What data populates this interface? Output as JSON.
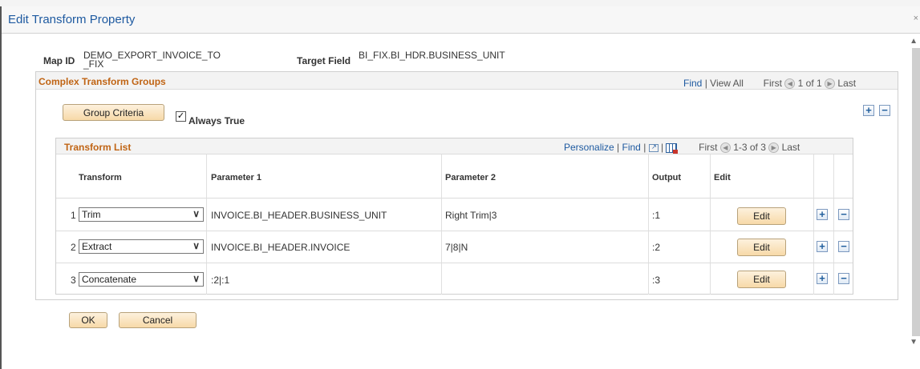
{
  "dialog": {
    "title": "Edit Transform Property",
    "close_label": "×"
  },
  "fields": {
    "map_id_label": "Map ID",
    "map_id_value_line1": "DEMO_EXPORT_INVOICE_TO",
    "map_id_value_line2": "_FIX",
    "target_field_label": "Target Field",
    "target_field_value": "BI_FIX.BI_HDR.BUSINESS_UNIT"
  },
  "groups": {
    "title": "Complex Transform Groups",
    "find": "Find",
    "separator": "|",
    "view_all": "View All",
    "first": "First",
    "range": "1 of 1",
    "last": "Last",
    "group_criteria_button": "Group Criteria",
    "always_true_checked": true,
    "always_true_label": "Always True"
  },
  "transform_list": {
    "title": "Transform List",
    "personalize": "Personalize",
    "find": "Find",
    "first": "First",
    "range": "1-3 of 3",
    "last": "Last",
    "columns": {
      "transform": "Transform",
      "parameter1": "Parameter 1",
      "parameter2": "Parameter 2",
      "output": "Output",
      "edit": "Edit"
    },
    "rows": [
      {
        "num": "1",
        "transform": "Trim",
        "parameter1": "INVOICE.BI_HEADER.BUSINESS_UNIT",
        "parameter2": "Right Trim|3",
        "output": ":1",
        "edit_label": "Edit"
      },
      {
        "num": "2",
        "transform": "Extract",
        "parameter1": "INVOICE.BI_HEADER.INVOICE",
        "parameter2": "7|8|N",
        "output": ":2",
        "edit_label": "Edit"
      },
      {
        "num": "3",
        "transform": "Concatenate",
        "parameter1": ":2|:1",
        "parameter2": "",
        "output": ":3",
        "edit_label": "Edit"
      }
    ]
  },
  "footer": {
    "ok": "OK",
    "cancel": "Cancel"
  },
  "icons": {
    "add": "+",
    "remove": "−",
    "prev": "◀",
    "next": "▶",
    "dropdown": "∨",
    "check": "✓"
  },
  "colors": {
    "title_blue": "#1e5aa0",
    "section_orange": "#c06414",
    "button_bg": "#f7d9a8"
  }
}
